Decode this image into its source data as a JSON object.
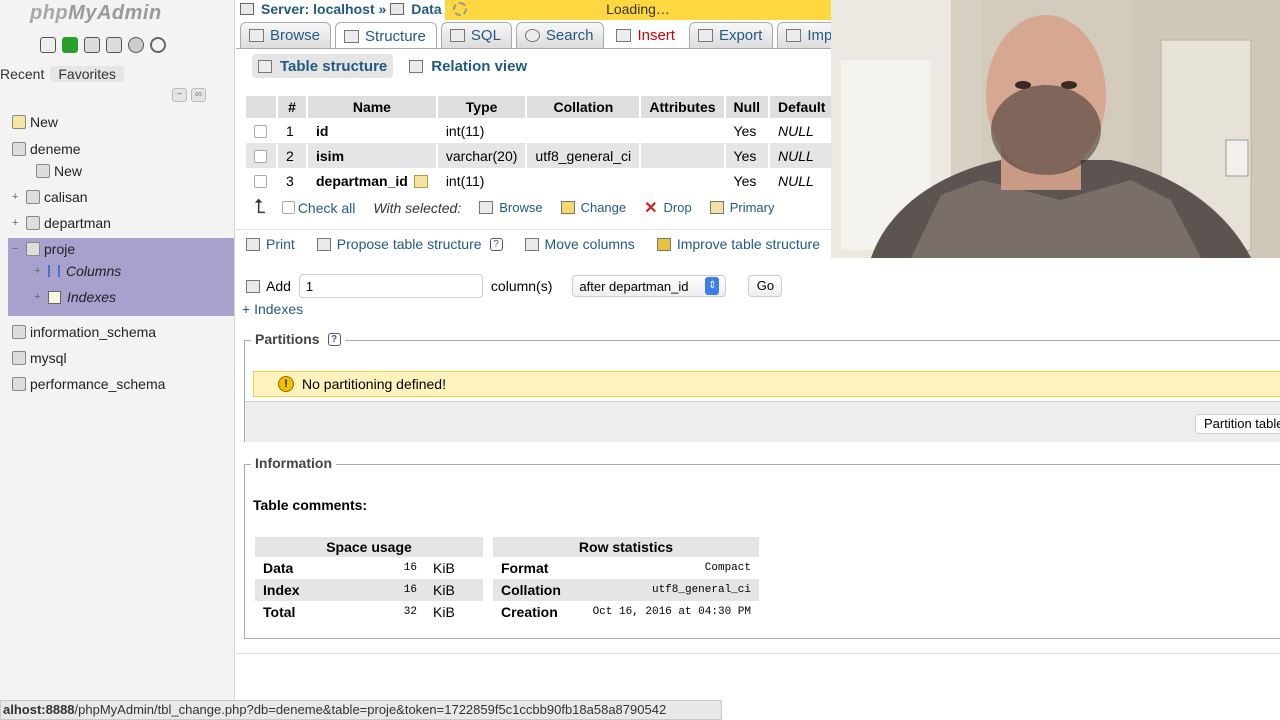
{
  "sidebar": {
    "logo_php": "php",
    "logo_myadmin": "MyAdmin",
    "recent_label": "Recent",
    "favorites_label": "Favorites",
    "tree": {
      "new_top": "New",
      "db_deneme": "deneme",
      "deneme_new": "New",
      "calisan": "calisan",
      "departman": "departman",
      "proje": "proje",
      "columns": "Columns",
      "indexes": "Indexes",
      "information_schema": "information_schema",
      "mysql": "mysql",
      "performance_schema": "performance_schema"
    },
    "highlight_color": "#a7a1cd"
  },
  "breadcrumb": {
    "server": "Server: localhost »",
    "database": "Data"
  },
  "loading_text": "Loading…",
  "tabs": {
    "browse": "Browse",
    "structure": "Structure",
    "sql": "SQL",
    "search": "Search",
    "insert": "Insert",
    "export": "Export",
    "import": "Import"
  },
  "subtabs": {
    "table_structure": "Table structure",
    "relation_view": "Relation view"
  },
  "structure_table": {
    "headers": [
      "#",
      "Name",
      "Type",
      "Collation",
      "Attributes",
      "Null",
      "Default"
    ],
    "rows": [
      {
        "num": "1",
        "name": "id",
        "type": "int(11)",
        "collation": "",
        "attributes": "",
        "null": "Yes",
        "default": "NULL"
      },
      {
        "num": "2",
        "name": "isim",
        "type": "varchar(20)",
        "collation": "utf8_general_ci",
        "attributes": "",
        "null": "Yes",
        "default": "NULL"
      },
      {
        "num": "3",
        "name": "departman_id",
        "type": "int(11)",
        "collation": "",
        "attributes": "",
        "null": "Yes",
        "default": "NULL"
      }
    ]
  },
  "with_selected": {
    "check_all": "Check all",
    "label": "With selected:",
    "browse": "Browse",
    "change": "Change",
    "drop": "Drop",
    "primary": "Primary"
  },
  "actions": {
    "print": "Print",
    "propose": "Propose table structure",
    "move_columns": "Move columns",
    "improve": "Improve table structure"
  },
  "add_columns": {
    "add_label": "Add",
    "count_value": "1",
    "columns_label": "column(s)",
    "position_value": "after departman_id",
    "go_label": "Go"
  },
  "indexes_link": "+ Indexes",
  "partitions": {
    "legend": "Partitions",
    "notice": "No partitioning defined!",
    "button": "Partition table"
  },
  "information": {
    "legend": "Information",
    "table_comments": "Table comments:",
    "space_usage": {
      "header": "Space usage",
      "rows": [
        {
          "label": "Data",
          "value": "16",
          "unit": "KiB"
        },
        {
          "label": "Index",
          "value": "16",
          "unit": "KiB"
        },
        {
          "label": "Total",
          "value": "32",
          "unit": "KiB"
        }
      ]
    },
    "row_statistics": {
      "header": "Row statistics",
      "rows": [
        {
          "label": "Format",
          "value": "Compact"
        },
        {
          "label": "Collation",
          "value": "utf8_general_ci"
        },
        {
          "label": "Creation",
          "value": "Oct 16, 2016 at 04:30 PM"
        }
      ]
    }
  },
  "status_bar": {
    "host": "alhost:8888",
    "path": "/phpMyAdmin/tbl_change.php?db=deneme&table=proje&token=1722859f5c1ccbb90fb18a58a8790542"
  },
  "colors": {
    "link": "#235a81",
    "insert_tab": "#d10000",
    "loading_bg": "#ffd841",
    "notice_bg": "#fff3bd"
  }
}
